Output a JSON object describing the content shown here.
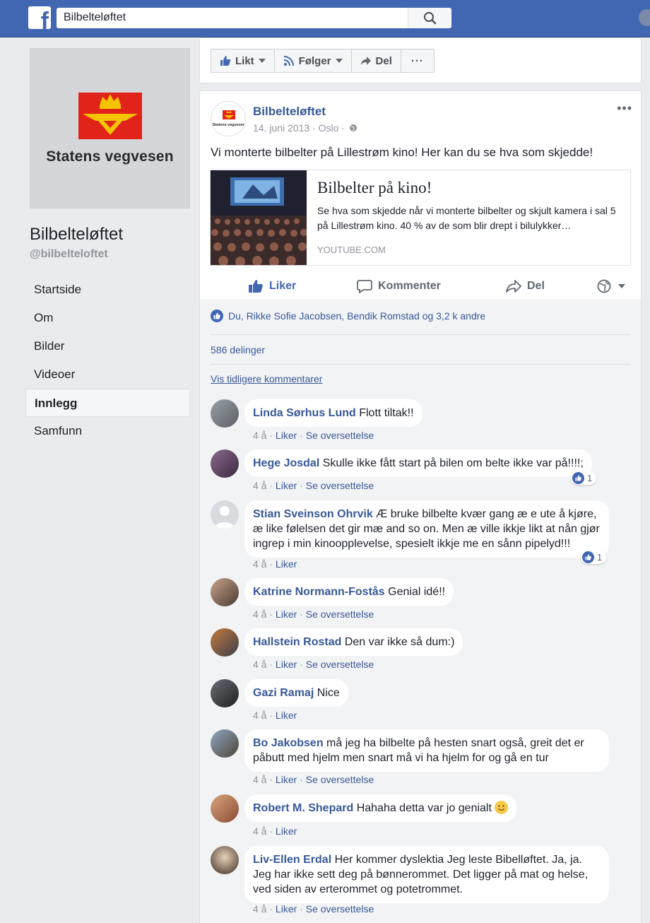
{
  "topbar": {
    "search_value": "Bilbelteløftet",
    "logo": "f"
  },
  "sidebar": {
    "logo_text": "Statens vegvesen",
    "page_name": "Bilbelteløftet",
    "handle": "@bilbelteloftet",
    "items": [
      {
        "label": "Startside"
      },
      {
        "label": "Om"
      },
      {
        "label": "Bilder"
      },
      {
        "label": "Videoer"
      },
      {
        "label": "Innlegg"
      },
      {
        "label": "Samfunn"
      }
    ]
  },
  "actionbar": {
    "liked": "Likt",
    "following": "Følger",
    "share": "Del",
    "more": "···"
  },
  "post": {
    "author": "Bilbelteløftet",
    "date": "14. juni 2013 · Oslo ·",
    "avatar_text": "Statens vegvesen",
    "text": "Vi monterte bilbelter på Lillestrøm kino! Her kan du se hva som skjedde!",
    "link": {
      "title": "Bilbelter på kino!",
      "description": "Se hva som skjedde når vi monterte bilbelter og skjult kamera i sal 5 på Lillestrøm kino. 40 % av de som blir drept i bilulykker…",
      "domain": "YOUTUBE.COM"
    },
    "actions": {
      "like": "Liker",
      "comment": "Kommenter",
      "share": "Del"
    },
    "reactions_text": "Du, Rikke Sofie Jacobsen, Bendik Romstad og 3,2 k andre",
    "shares_text": "586 delinger",
    "previous_comments": "Vis tidligere kommentarer"
  },
  "comment_meta": {
    "time": "4 å",
    "like": "Liker",
    "translate": "Se oversettelse",
    "dot": "·"
  },
  "comments": [
    {
      "name": "Linda Sørhus Lund",
      "text": "Flott tiltak!!"
    },
    {
      "name": "Hege Josdal",
      "text": "Skulle ikke fått start på bilen om belte ikke var på!!!!;",
      "reactions": "1"
    },
    {
      "name": "Stian Sveinson Ohrvik",
      "text": "Æ bruke bilbelte kvær gang æ e ute å kjøre, æ like følelsen det gir mæ and so on. Men æ ville ikkje likt at nån gjør ingrep i min kinoopplevelse, spesielt ikkje me en sånn pipelyd!!!",
      "reactions": "1"
    },
    {
      "name": "Katrine Normann-Fostås",
      "text": "Genial idé!!"
    },
    {
      "name": "Hallstein Rostad",
      "text": "Den var ikke så dum:)"
    },
    {
      "name": "Gazi Ramaj",
      "text": "Nice"
    },
    {
      "name": "Bo Jakobsen",
      "text": "må jeg ha bilbelte på hesten snart også, greit det er påbutt med hjelm men snart må vi ha hjelm for og gå en tur"
    },
    {
      "name": "Robert M. Shepard",
      "text": "Hahaha detta var jo genialt"
    },
    {
      "name": "Liv-Ellen Erdal",
      "text": "Her kommer dyslektia Jeg leste Bibelløftet. Ja, ja. Jeg har ikke sett deg på bønnerommet. Det ligger på mat og helse, ved siden av erterommet og potetrommet."
    }
  ],
  "colors": {
    "brand": "#4267b2",
    "link": "#385898",
    "background": "#e9ebee"
  }
}
